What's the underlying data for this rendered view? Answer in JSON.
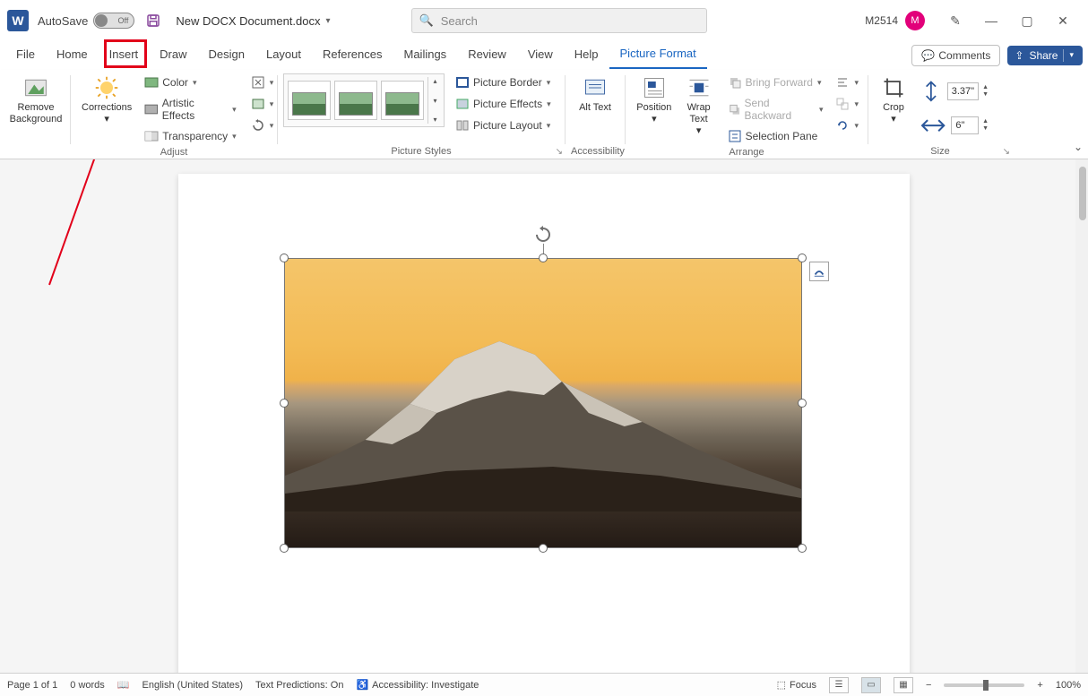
{
  "titlebar": {
    "autosave_label": "AutoSave",
    "autosave_off": "Off",
    "doc_name": "New DOCX Document.docx",
    "search_placeholder": "Search",
    "username": "M2514",
    "avatar_initial": "M"
  },
  "tabs": {
    "file": "File",
    "home": "Home",
    "insert": "Insert",
    "draw": "Draw",
    "design": "Design",
    "layout": "Layout",
    "references": "References",
    "mailings": "Mailings",
    "review": "Review",
    "view": "View",
    "help": "Help",
    "picture_format": "Picture Format",
    "comments": "Comments",
    "share": "Share"
  },
  "ribbon": {
    "remove_bg": "Remove Background",
    "corrections": "Corrections",
    "color": "Color",
    "artistic": "Artistic Effects",
    "transparency": "Transparency",
    "adjust_label": "Adjust",
    "styles_label": "Picture Styles",
    "border": "Picture Border",
    "effects": "Picture Effects",
    "layout": "Picture Layout",
    "alt_text": "Alt Text",
    "accessibility_label": "Accessibility",
    "position": "Position",
    "wrap": "Wrap Text",
    "bring_forward": "Bring Forward",
    "send_backward": "Send Backward",
    "selection_pane": "Selection Pane",
    "arrange_label": "Arrange",
    "crop": "Crop",
    "size_label": "Size",
    "height": "3.37\"",
    "width": "6\""
  },
  "status": {
    "page": "Page 1 of 1",
    "words": "0 words",
    "language": "English (United States)",
    "predictions": "Text Predictions: On",
    "accessibility": "Accessibility: Investigate",
    "focus": "Focus",
    "zoom": "100%"
  }
}
